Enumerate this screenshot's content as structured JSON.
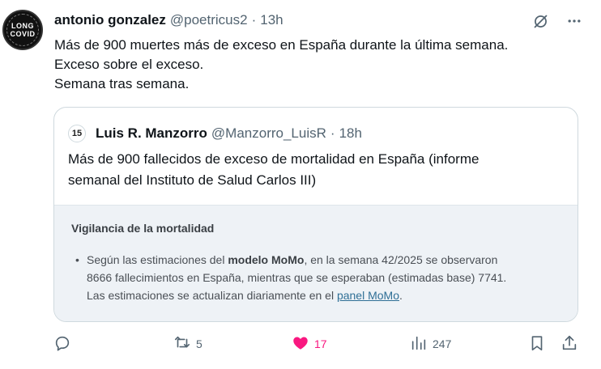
{
  "author": {
    "name": "antonio gonzalez",
    "handle": "@poetricus2",
    "separator": "·",
    "time": "13h",
    "avatar_text": "LONG\nCOVID"
  },
  "tweet_lines": [
    "Más de 900 muertes más de exceso en España durante la última semana.",
    "Exceso sobre el exceso.",
    "Semana tras semana."
  ],
  "quote": {
    "name": "Luis R. Manzorro",
    "handle": "@Manzorro_LuisR",
    "separator": "·",
    "time": "18h",
    "avatar_text": "15",
    "text_lines": [
      "Más de 900 fallecidos de exceso de mortalidad en España (informe",
      "semanal del Instituto de Salud Carlos III)"
    ],
    "media": {
      "title": "Vigilancia de la mortalidad",
      "bullet": "•",
      "line1_pre": "Según las estimaciones del ",
      "line1_bold": "modelo MoMo",
      "line1_post": ", en la semana 42/2025 se observaron",
      "line2": "8666 fallecimientos en España, mientras que se esperaban (estimadas base) 7741.",
      "line3_pre": "Las estimaciones se actualizan diariamente en el ",
      "line3_link": "panel MoMo",
      "line3_post": "."
    }
  },
  "actions": {
    "reply_count": "",
    "retweet_count": "5",
    "like_count": "17",
    "views_count": "247"
  },
  "colors": {
    "like": "#f91880",
    "muted": "#536471",
    "text": "#0f1419",
    "link": "#2f6f96"
  },
  "icons": [
    "grok-icon",
    "more-icon",
    "reply-icon",
    "retweet-icon",
    "like-icon",
    "views-icon",
    "bookmark-icon",
    "share-icon"
  ]
}
